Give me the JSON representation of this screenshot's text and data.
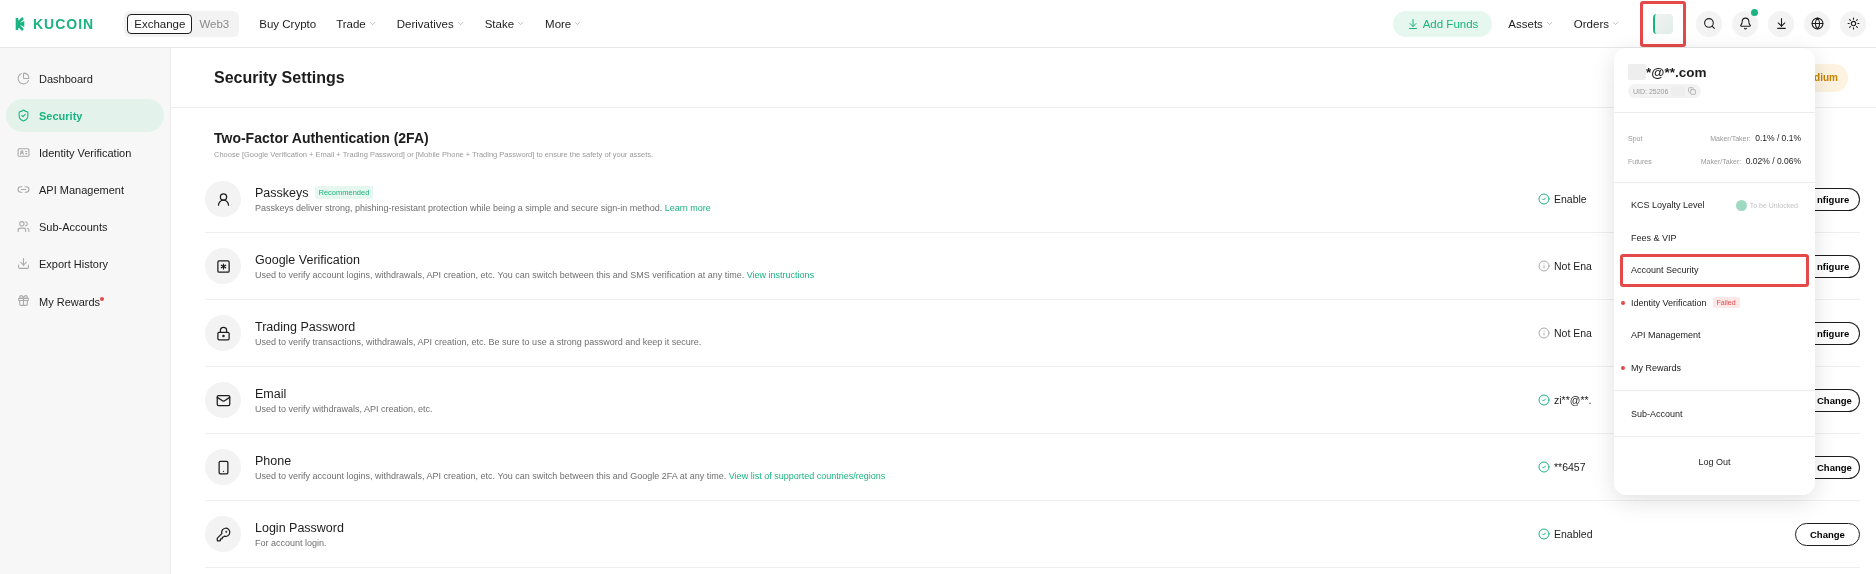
{
  "header": {
    "logo": "KUCOIN",
    "switch": [
      {
        "label": "Exchange",
        "selected": true
      },
      {
        "label": "Web3",
        "selected": false
      }
    ],
    "nav": [
      {
        "label": "Buy Crypto",
        "caret": false
      },
      {
        "label": "Trade",
        "caret": true
      },
      {
        "label": "Derivatives",
        "caret": true
      },
      {
        "label": "Stake",
        "caret": true
      },
      {
        "label": "More",
        "caret": true
      }
    ],
    "add_funds": "Add Funds",
    "menus": [
      {
        "label": "Assets"
      },
      {
        "label": "Orders"
      }
    ],
    "avatar": {
      "highlighted": true
    },
    "notifications": {
      "unread": true
    }
  },
  "sidebar": {
    "items": [
      {
        "label": "Dashboard",
        "selected": false,
        "dot": false
      },
      {
        "label": "Security",
        "selected": true,
        "dot": false
      },
      {
        "label": "Identity Verification",
        "selected": false,
        "dot": false
      },
      {
        "label": "API Management",
        "selected": false,
        "dot": false
      },
      {
        "label": "Sub-Accounts",
        "selected": false,
        "dot": false
      },
      {
        "label": "Export History",
        "selected": false,
        "dot": false
      },
      {
        "label": "My Rewards",
        "selected": false,
        "dot": true
      }
    ]
  },
  "page": {
    "title": "Security Settings",
    "level_badge": "dium"
  },
  "section": {
    "title": "Two-Factor Authentication (2FA)",
    "subtitle": "Choose [Google Verification + Email + Trading Password] or [Mobile Phone + Trading Password] to ensure the safety of your assets."
  },
  "rows": [
    {
      "title": "Passkeys",
      "badge": "Recommended",
      "description": "Passkeys deliver strong, phishing-resistant protection while being a simple and secure sign-in method.",
      "link": "Learn more",
      "status": "Enable",
      "enabled": true,
      "button": "nfigure",
      "partial": true
    },
    {
      "title": "Google Verification",
      "description": "Used to verify account logins, withdrawals, API creation, etc. You can switch between this and SMS verification at any time.",
      "link": "View instructions",
      "status": "Not Ena",
      "enabled": false,
      "button": "nfigure",
      "partial": true
    },
    {
      "title": "Trading Password",
      "description": "Used to verify transactions, withdrawals, API creation, etc. Be sure to use a strong password and keep it secure.",
      "status": "Not Ena",
      "enabled": false,
      "button": "nfigure",
      "partial": true
    },
    {
      "title": "Email",
      "description": "Used to verify withdrawals, API creation, etc.",
      "status": "zi**@**.",
      "enabled": true,
      "button": "Change",
      "partial": true
    },
    {
      "title": "Phone",
      "description": "Used to verify account logins, withdrawals, API creation, etc. You can switch between this and Google 2FA at any time.",
      "link": "View list of supported countries/regions",
      "status": "**6457",
      "enabled": true,
      "button": "Change",
      "partial": true
    },
    {
      "title": "Login Password",
      "description": "For account login.",
      "status": "Enabled",
      "enabled": true,
      "button": "Change",
      "partial": false
    }
  ],
  "account_menu": {
    "email": "*@**.com",
    "uid": "UID: 25206",
    "fees": [
      {
        "market": "Spot",
        "label": "Maker/Taker:",
        "value": "0.1% / 0.1%"
      },
      {
        "market": "Futures",
        "label": "Maker/Taker:",
        "value": "0.02% / 0.06%"
      }
    ],
    "items": [
      {
        "label": "KCS Loyalty Level",
        "status": "To be Unlocked",
        "dot": false,
        "highlighted": false
      },
      {
        "label": "Fees & VIP",
        "dot": false,
        "highlighted": false
      },
      {
        "label": "Account Security",
        "dot": false,
        "highlighted": true
      },
      {
        "label": "Identity Verification",
        "tag": "Failed",
        "dot": true,
        "highlighted": false
      },
      {
        "label": "API Management",
        "dot": false,
        "highlighted": false
      },
      {
        "label": "My Rewards",
        "dot": true,
        "highlighted": false
      }
    ],
    "sub_account": "Sub-Account",
    "logout": "Log Out"
  }
}
